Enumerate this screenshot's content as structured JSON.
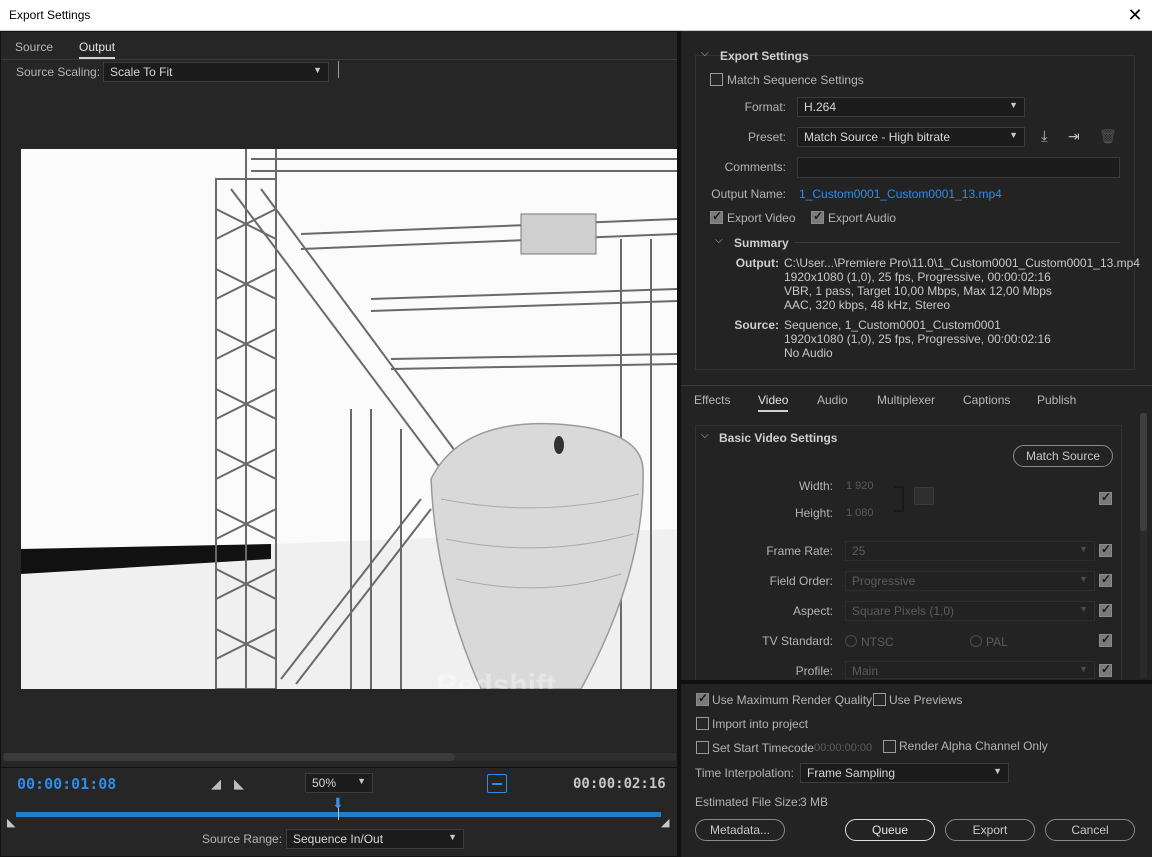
{
  "window": {
    "title": "Export Settings",
    "close_glyph": "✕"
  },
  "left": {
    "tabs": [
      "Source",
      "Output"
    ],
    "scaling_label": "Source Scaling:",
    "scaling_value": "Scale To Fit",
    "watermark_text": "Redshift",
    "timecode_current": "00:00:01:08",
    "timecode_end": "00:00:02:16",
    "zoom": "50%",
    "source_range_label": "Source Range:",
    "source_range_value": "Sequence In/Out"
  },
  "export_settings": {
    "header": "Export Settings",
    "match_sequence": "Match Sequence Settings",
    "format_label": "Format:",
    "format_value": "H.264",
    "preset_label": "Preset:",
    "preset_value": "Match Source - High bitrate",
    "comments_label": "Comments:",
    "output_name_label": "Output Name:",
    "output_name_value": "1_Custom0001_Custom0001_13.mp4",
    "export_video": "Export Video",
    "export_audio": "Export Audio"
  },
  "summary": {
    "header": "Summary",
    "output_label": "Output:",
    "output_lines": [
      "C:\\User...\\Premiere Pro\\11.0\\1_Custom0001_Custom0001_13.mp4",
      "1920x1080 (1,0), 25 fps, Progressive, 00:00:02:16",
      "VBR, 1 pass, Target 10,00 Mbps, Max 12,00 Mbps",
      "AAC, 320 kbps, 48 kHz, Stereo"
    ],
    "source_label": "Source:",
    "source_lines": [
      "Sequence, 1_Custom0001_Custom0001",
      "1920x1080 (1,0), 25 fps, Progressive, 00:00:02:16",
      "No Audio"
    ]
  },
  "tabs": [
    "Effects",
    "Video",
    "Audio",
    "Multiplexer",
    "Captions",
    "Publish"
  ],
  "video": {
    "header": "Basic Video Settings",
    "match_source": "Match Source",
    "width_label": "Width:",
    "width_value": "1 920",
    "height_label": "Height:",
    "height_value": "1 080",
    "frame_rate_label": "Frame Rate:",
    "frame_rate_value": "25",
    "field_order_label": "Field Order:",
    "field_order_value": "Progressive",
    "aspect_label": "Aspect:",
    "aspect_value": "Square Pixels (1,0)",
    "tv_label": "TV Standard:",
    "tv_ntsc": "NTSC",
    "tv_pal": "PAL",
    "profile_label": "Profile:",
    "profile_value": "Main"
  },
  "bottom": {
    "max_quality": "Use Maximum Render Quality",
    "use_previews": "Use Previews",
    "import_project": "Import into project",
    "set_start_tc": "Set Start Timecode",
    "start_tc_value": "00:00:00:00",
    "alpha_only": "Render Alpha Channel Only",
    "interp_label": "Time Interpolation:",
    "interp_value": "Frame Sampling",
    "file_size_label": "Estimated File Size:",
    "file_size_value": "3 MB",
    "metadata_btn": "Metadata...",
    "queue_btn": "Queue",
    "export_btn": "Export",
    "cancel_btn": "Cancel"
  }
}
